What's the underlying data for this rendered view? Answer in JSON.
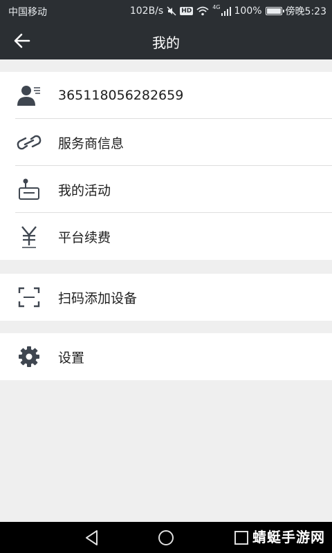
{
  "status_bar": {
    "carrier": "中国移动",
    "speed": "102B/s",
    "hd": "HD",
    "network": "4G",
    "battery": "100%",
    "time": "傍晚5:23"
  },
  "header": {
    "title": "我的"
  },
  "profile": {
    "user_id": "365118056282659"
  },
  "menu": {
    "provider_info": "服务商信息",
    "my_activity": "我的活动",
    "platform_renewal": "平台续费",
    "scan_add_device": "扫码添加设备",
    "settings": "设置"
  },
  "watermark": "蜻蜓手游网",
  "colors": {
    "bar": "#2b2f33",
    "icon": "#3f4650",
    "background": "#efefef"
  }
}
